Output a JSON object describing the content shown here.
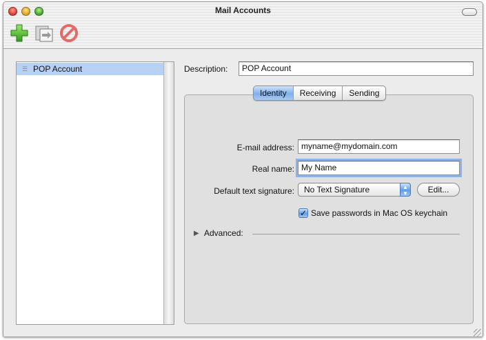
{
  "window": {
    "title": "Mail Accounts"
  },
  "toolbar": {
    "add_icon": "plus-icon",
    "duplicate_icon": "duplicate-icon",
    "delete_icon": "delete-icon"
  },
  "accounts": {
    "items": [
      {
        "label": "POP Account",
        "selected": true
      }
    ]
  },
  "description": {
    "label": "Description:",
    "value": "POP Account"
  },
  "tabs": [
    {
      "label": "Identity",
      "active": true
    },
    {
      "label": "Receiving",
      "active": false
    },
    {
      "label": "Sending",
      "active": false
    }
  ],
  "identity": {
    "email_label": "E-mail address:",
    "email_value": "myname@mydomain.com",
    "name_label": "Real name:",
    "name_value": "My Name",
    "signature_label": "Default text signature:",
    "signature_value": "No Text Signature",
    "edit_label": "Edit...",
    "keychain_label": "Save passwords in Mac OS keychain",
    "keychain_checked": true,
    "advanced_label": "Advanced:"
  },
  "colors": {
    "selection": "#b7d1f4",
    "accent": "#5f9de8",
    "focus_ring": "#8db3e8"
  }
}
